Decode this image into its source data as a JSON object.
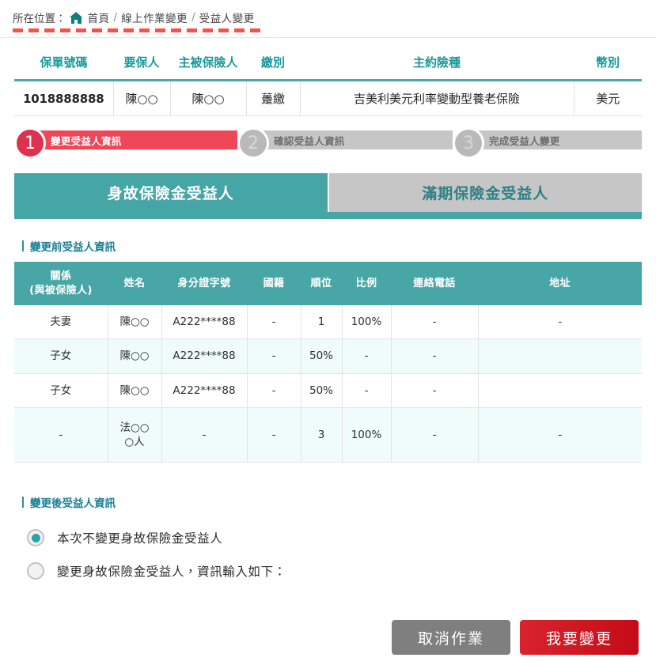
{
  "breadcrumb": {
    "prefix": "所在位置：",
    "home_label": "首頁",
    "items": [
      "線上作業變更",
      "受益人變更"
    ],
    "separator": "/",
    "home_icon": "home-icon"
  },
  "policy": {
    "headers": [
      "保單號碼",
      "要保人",
      "主被保險人",
      "繳別",
      "主約險種",
      "幣別"
    ],
    "row": {
      "policy_no": "1018888888",
      "applicant": "陳○○",
      "insured": "陳○○",
      "payment_type": "躉繳",
      "product": "吉美利美元利率變動型養老保險",
      "currency": "美元"
    }
  },
  "steps": [
    {
      "number": "1",
      "label": "變更受益人資訊",
      "state": "active"
    },
    {
      "number": "2",
      "label": "確認受益人資訊",
      "state": "idle"
    },
    {
      "number": "3",
      "label": "完成受益人變更",
      "state": "idle"
    }
  ],
  "tabs": [
    {
      "label": "身故保險金受益人",
      "state": "active"
    },
    {
      "label": "滿期保險金受益人",
      "state": "idle"
    }
  ],
  "before_section": {
    "title": "變更前受益人資訊",
    "headers": [
      "關係\n(與被保險人)",
      "姓名",
      "身分證字號",
      "國籍",
      "順位",
      "比例",
      "連絡電話",
      "地址"
    ],
    "header_relation_line1": "關係",
    "header_relation_line2": "(與被保險人)",
    "rows": [
      {
        "relation": "夫妻",
        "name": "陳○○",
        "id_no": "A222****88",
        "nationality": "-",
        "order": "1",
        "ratio": "100%",
        "phone": "-",
        "address": "-"
      },
      {
        "relation": "子女",
        "name": "陳○○",
        "id_no": "A222****88",
        "nationality": "-",
        "order": "50%",
        "ratio": "-",
        "phone": "-",
        "address": ""
      },
      {
        "relation": "子女",
        "name": "陳○○",
        "id_no": "A222****88",
        "nationality": "-",
        "order": "50%",
        "ratio": "-",
        "phone": "-",
        "address": ""
      },
      {
        "relation": "-",
        "name": "法○○\n○人",
        "name_line1": "法○○",
        "name_line2": "○人",
        "id_no": "-",
        "nationality": "-",
        "order": "3",
        "ratio": "100%",
        "phone": "-",
        "address": "-"
      }
    ]
  },
  "after_section": {
    "title": "變更後受益人資訊",
    "options": [
      {
        "label": "本次不變更身故保險金受益人",
        "selected": true
      },
      {
        "label": "變更身故保險金受益人，資訊輸入如下：",
        "selected": false
      }
    ]
  },
  "buttons": {
    "cancel": "取消作業",
    "submit": "我要變更"
  },
  "colors": {
    "teal": "#46a5a5",
    "teal_text": "#17999c",
    "red_accent": "#ef4658",
    "submit_red": "#c40c18",
    "dashed_red": "#f4534d",
    "section_title": "#1c7f96"
  }
}
